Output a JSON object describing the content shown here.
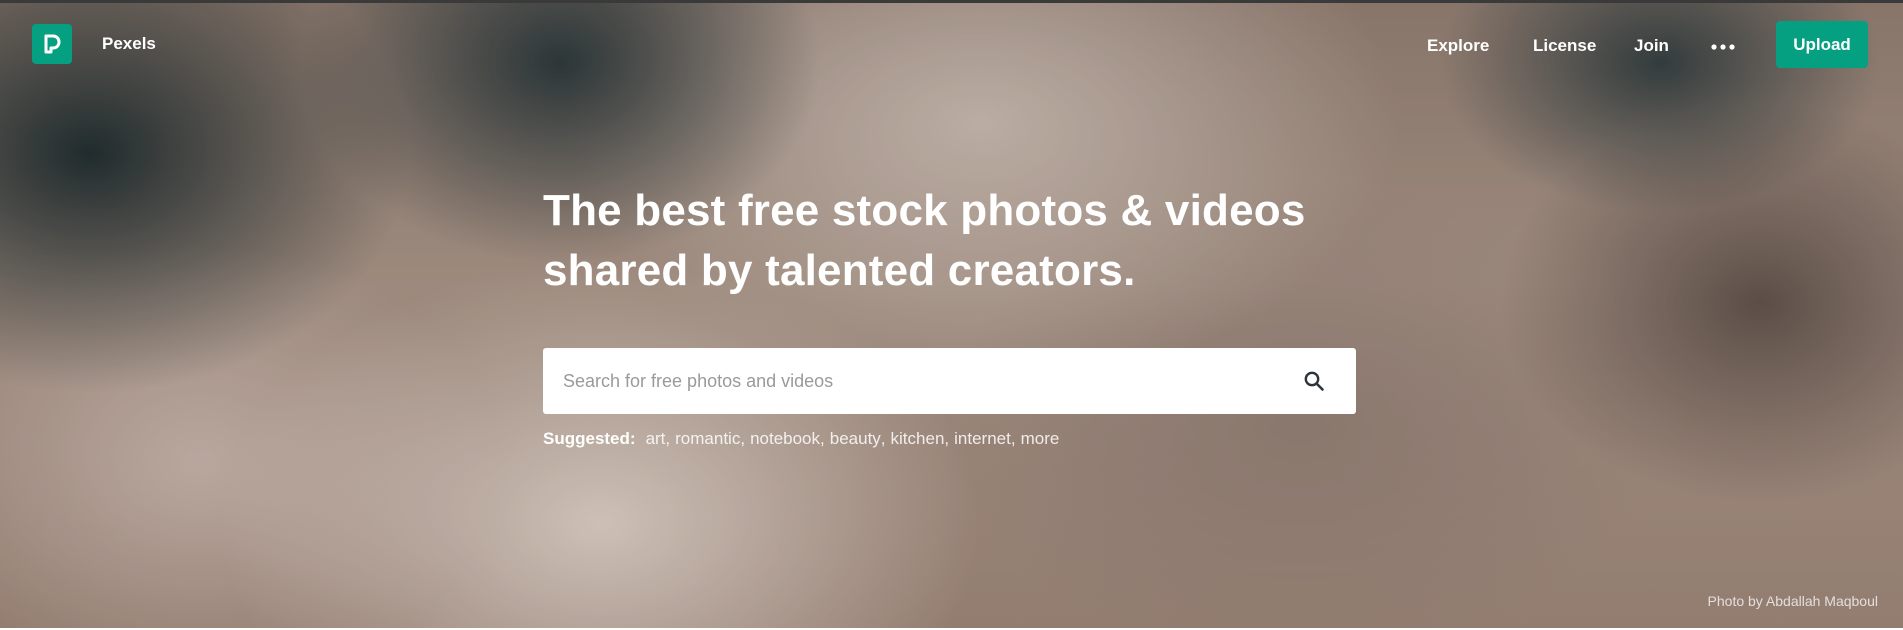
{
  "header": {
    "brand": "Pexels",
    "nav": {
      "explore": "Explore",
      "license": "License",
      "join": "Join"
    },
    "more_icon": "more-horizontal-icon",
    "upload_label": "Upload"
  },
  "hero": {
    "headline_line1": "The best free stock photos & videos",
    "headline_line2": "shared by talented creators."
  },
  "search": {
    "placeholder": "Search for free photos and videos",
    "value": "",
    "icon": "search-icon"
  },
  "suggested": {
    "label": "Suggested:",
    "items": [
      "art",
      "romantic",
      "notebook",
      "beauty",
      "kitchen",
      "internet",
      "more"
    ]
  },
  "photo_credit": "Photo by Abdallah Maqboul",
  "colors": {
    "brand": "#05a081",
    "text_on_hero": "#ffffff"
  }
}
